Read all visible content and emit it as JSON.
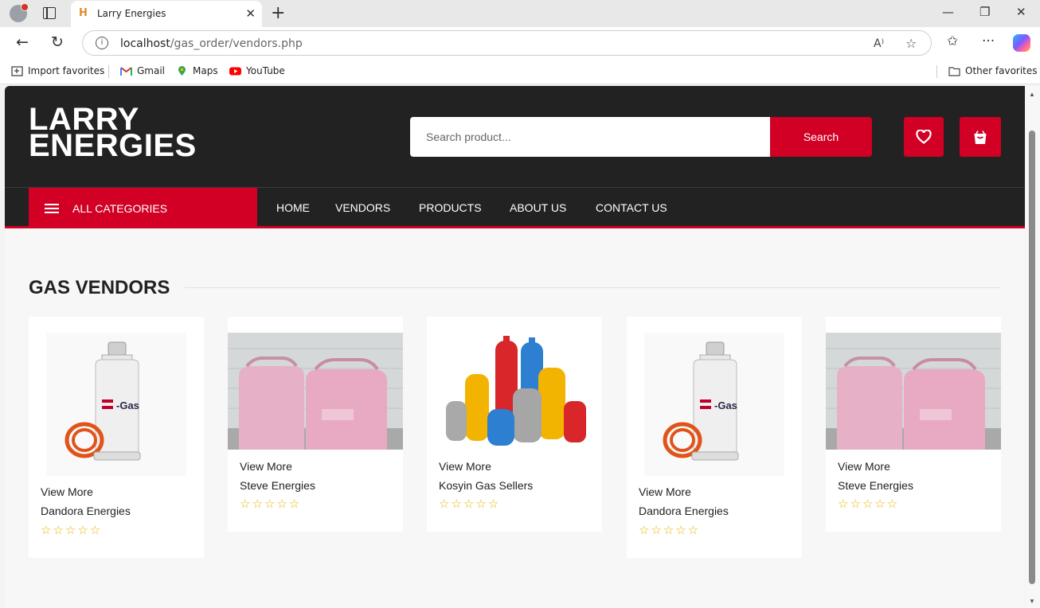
{
  "browser": {
    "tab_title": "Larry Energies",
    "tab_favicon_letter": "H",
    "url_host": "localhost",
    "url_path": "/gas_order/vendors.php",
    "favorites": [
      "Import favorites",
      "Gmail",
      "Maps",
      "YouTube"
    ],
    "other_favorites": "Other favorites"
  },
  "site": {
    "logo_line1": "LARRY",
    "logo_line2": "ENERGIES",
    "search_placeholder": "Search product...",
    "search_button": "Search",
    "all_categories": "ALL CATEGORIES",
    "nav": [
      "HOME",
      "VENDORS",
      "PRODUCTS",
      "ABOUT US",
      "CONTACT US"
    ],
    "accent_color": "#d10024"
  },
  "section": {
    "title": "GAS VENDORS"
  },
  "vendors": [
    {
      "link": "View More",
      "name": "Dandora Energies",
      "rating": 0,
      "image": "white-lpg-cylinder"
    },
    {
      "link": "View More",
      "name": "Steve Energies",
      "rating": 0,
      "image": "pink-gas-cylinders"
    },
    {
      "link": "View More",
      "name": "Kosyin Gas Sellers",
      "rating": 0,
      "image": "assorted-gas-cylinders"
    },
    {
      "link": "View More",
      "name": "Dandora Energies",
      "rating": 0,
      "image": "white-lpg-cylinder"
    },
    {
      "link": "View More",
      "name": "Steve Energies",
      "rating": 0,
      "image": "pink-gas-cylinders"
    }
  ],
  "stars_text": "☆☆☆☆☆"
}
